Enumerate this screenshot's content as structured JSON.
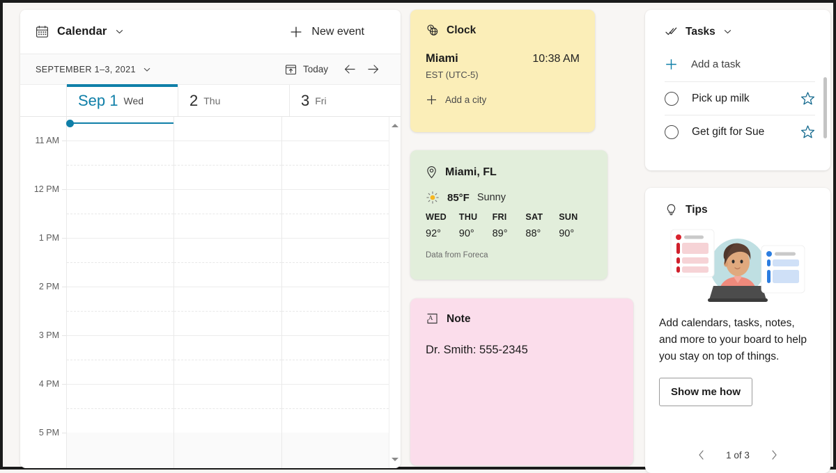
{
  "calendar": {
    "icon": "calendar-icon",
    "title": "Calendar",
    "chevron": "chevron-down-icon",
    "new_event_label": "New event",
    "new_event_icon": "plus-icon",
    "date_range": "SEPTEMBER 1–3, 2021",
    "range_chevron": "chevron-down-icon",
    "today_label": "Today",
    "today_icon": "today-calendar-icon",
    "prev_icon": "arrow-left-icon",
    "next_icon": "arrow-right-icon",
    "accent_color": "#0f7fa8",
    "days": [
      {
        "num": "Sep 1",
        "dow": "Wed",
        "today": true
      },
      {
        "num": "2",
        "dow": "Thu",
        "today": false
      },
      {
        "num": "3",
        "dow": "Fri",
        "today": false
      }
    ],
    "time_labels": [
      "11 AM",
      "12 PM",
      "1 PM",
      "2 PM",
      "3 PM",
      "4 PM",
      "5 PM"
    ],
    "current_time_indicator": "10:38 AM"
  },
  "clock": {
    "icon": "world-clock-icon",
    "title": "Clock",
    "city": "Miami",
    "time": "10:38 AM",
    "timezone": "EST (UTC-5)",
    "add_icon": "plus-icon",
    "add_label": "Add a city",
    "bg_color": "#fbeeb8"
  },
  "weather": {
    "location_icon": "location-pin-icon",
    "location": "Miami, FL",
    "condition_icon": "sun-icon",
    "temperature": "85°F",
    "condition": "Sunny",
    "forecast": [
      {
        "day": "WED",
        "high": "92°"
      },
      {
        "day": "THU",
        "high": "90°"
      },
      {
        "day": "FRI",
        "high": "89°"
      },
      {
        "day": "SAT",
        "high": "88°"
      },
      {
        "day": "SUN",
        "high": "90°"
      }
    ],
    "source": "Data from Foreca",
    "bg_color": "#e2eedb"
  },
  "note": {
    "icon": "note-text-icon",
    "title": "Note",
    "body": "Dr. Smith: 555-2345",
    "bg_color": "#fbddeb"
  },
  "tasks": {
    "icon": "tasks-check-icon",
    "title": "Tasks",
    "chevron": "chevron-down-icon",
    "add_icon": "plus-icon",
    "add_label": "Add a task",
    "items": [
      {
        "label": "Pick up milk",
        "checked": false,
        "starred": false
      },
      {
        "label": "Get gift for Sue",
        "checked": false,
        "starred": false
      }
    ]
  },
  "tips": {
    "icon": "lightbulb-icon",
    "title": "Tips",
    "illustration": "person-with-laptop-and-lists-illustration",
    "body": "Add calendars, tasks, notes, and more to your board to help you stay on top of things.",
    "button_label": "Show me how",
    "pager_label": "1 of 3",
    "prev_icon": "chevron-left-icon",
    "next_icon": "chevron-right-icon"
  }
}
